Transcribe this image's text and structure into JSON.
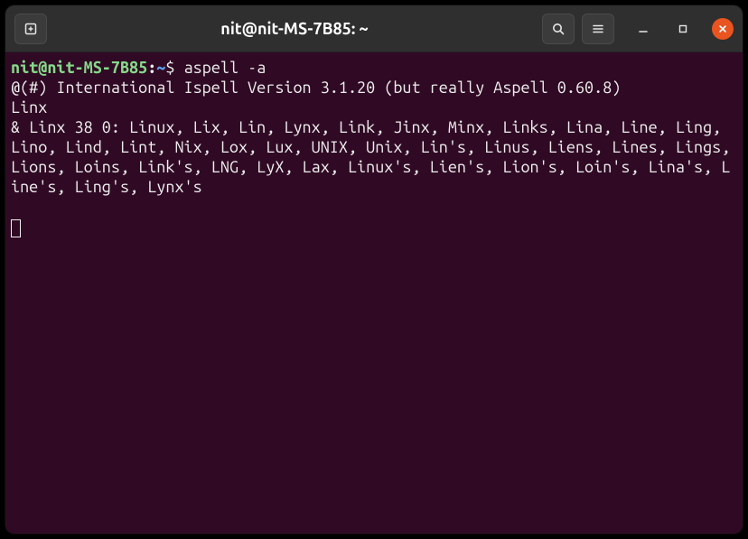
{
  "titlebar": {
    "title": "nit@nit-MS-7B85: ~"
  },
  "prompt": {
    "user_host": "nit@nit-MS-7B85",
    "sep": ":",
    "path": "~",
    "sigil": "$",
    "command": "aspell -a"
  },
  "output": {
    "banner": "@(#) International Ispell Version 3.1.20 (but really Aspell 0.60.8)",
    "input": "Linx",
    "suggestions": "& Linx 38 0: Linux, Lix, Lin, Lynx, Link, Jinx, Minx, Links, Lina, Line, Ling, Lino, Lind, Lint, Nix, Lox, Lux, UNIX, Unix, Lin's, Linus, Liens, Lines, Lings, Lions, Loins, Link's, LNG, LyX, Lax, Linux's, Lien's, Lion's, Loin's, Lina's, Line's, Ling's, Lynx's"
  }
}
